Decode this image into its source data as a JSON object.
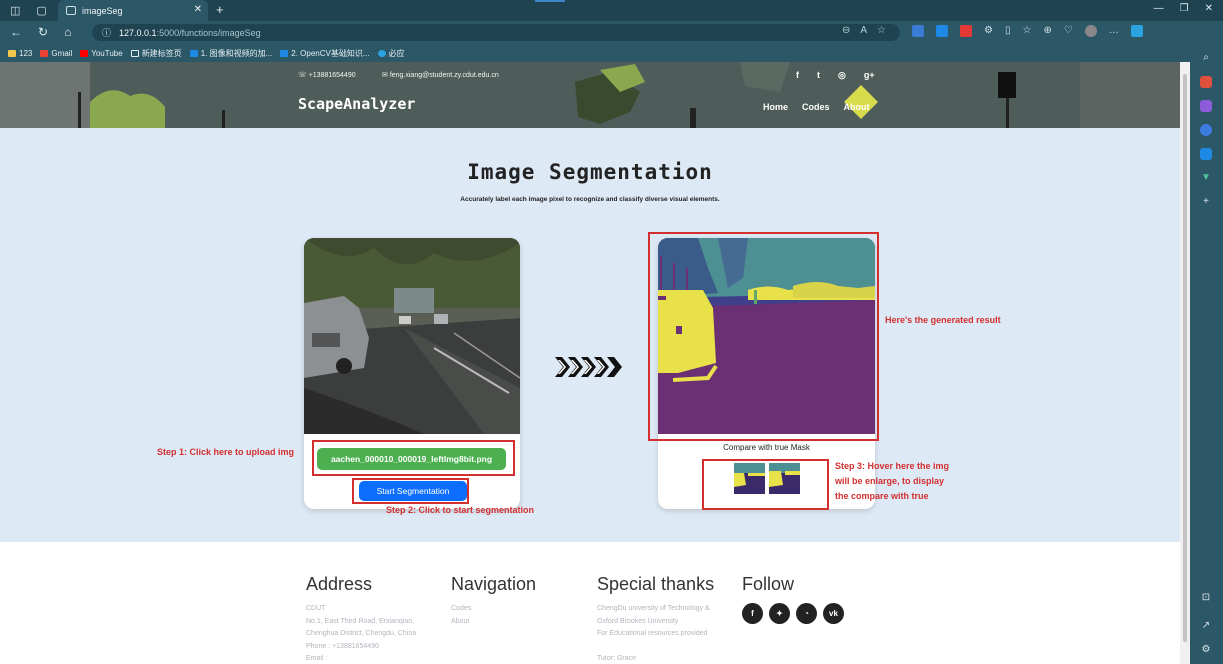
{
  "browser": {
    "tab_title": "imageSeg",
    "url_host": "127.0.0.1",
    "url_path": ":5000/functions/imageSeg",
    "bookmarks": [
      "123",
      "Gmail",
      "YouTube",
      "新建标签页",
      "1. 图像和视频的加...",
      "2. OpenCV基础知识...",
      "必应"
    ]
  },
  "header": {
    "phone": "+13881654490",
    "email": "feng.xiang@student.zy.cdut.edu.cn",
    "brand": "ScapeAnalyzer",
    "social": [
      "f",
      "t",
      "◎",
      "g+"
    ],
    "nav": [
      "Home",
      "Codes",
      "About"
    ]
  },
  "main": {
    "title": "Image Segmentation",
    "subtitle": "Accurately label each image pixel to recognize and classify diverse visual elements.",
    "file_button_label": "aachen_000010_000019_leftImg8bit.png",
    "start_button_label": "Start Segmentation",
    "compare_label": "Compare with true Mask"
  },
  "annotations": {
    "step1": "Step 1: Click here to upload img",
    "step2": "Step 2: Click to start segmentation",
    "step3_l1": "Step 3: Hover here the img",
    "step3_l2": "will be enlarge, to display",
    "step3_l3": "the compare with true",
    "result": "Here's the generated result"
  },
  "footer": {
    "address": {
      "heading": "Address",
      "lines": [
        "CDUT",
        "No.1, East Third Road, Erxianqiao,",
        "Chenghua District, Chengdu, China",
        "Phone : +13881654490",
        "Email :"
      ]
    },
    "navigation": {
      "heading": "Navigation",
      "lines": [
        "Codes",
        "About"
      ]
    },
    "thanks": {
      "heading": "Special thanks",
      "lines": [
        "ChengDu university of Technology &",
        "Oxford Brookes University",
        "For Educational resources provided",
        "",
        "Tutor: Grace"
      ]
    },
    "follow": {
      "heading": "Follow",
      "icons": [
        "f",
        "t",
        "rss",
        "vk"
      ]
    }
  },
  "colors": {
    "mask_purple": "#6b2f74",
    "mask_yellow": "#e8e14a",
    "mask_teal": "#4e8f93",
    "annotation_red": "#d32f2f",
    "file_button_green": "#4caf50",
    "start_button_blue": "#0d6efd"
  }
}
